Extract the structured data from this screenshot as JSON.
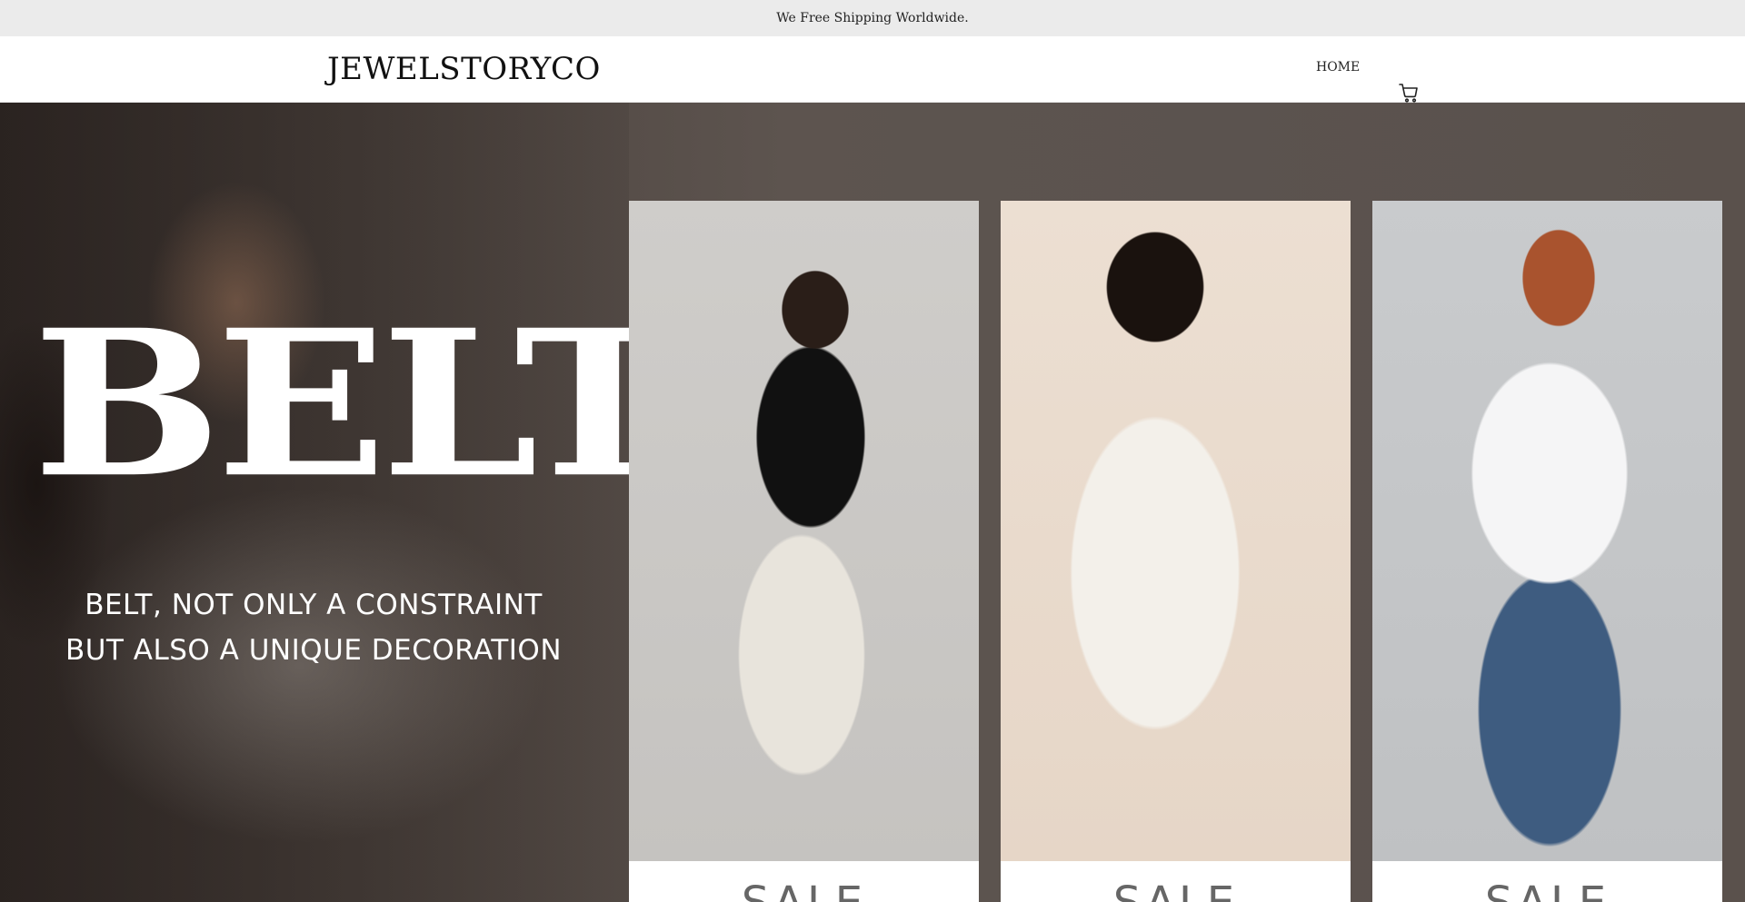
{
  "announcement": {
    "text": "We Free Shipping Worldwide."
  },
  "header": {
    "logo": "JEWELSTORYCO",
    "nav": [
      {
        "label": "HOME"
      }
    ],
    "cart_icon": "cart-icon"
  },
  "hero": {
    "title": "BELT",
    "subtitle_line1": "BELT, NOT ONLY A CONSTRAINT",
    "subtitle_line2": "BUT ALSO A UNIQUE DECORATION"
  },
  "cards": [
    {
      "label": "SALE"
    },
    {
      "label": "SALE"
    },
    {
      "label": "SALE"
    }
  ],
  "colors": {
    "announcement_bg": "#ebebeb",
    "header_bg": "#ffffff",
    "hero_text": "#ffffff"
  }
}
